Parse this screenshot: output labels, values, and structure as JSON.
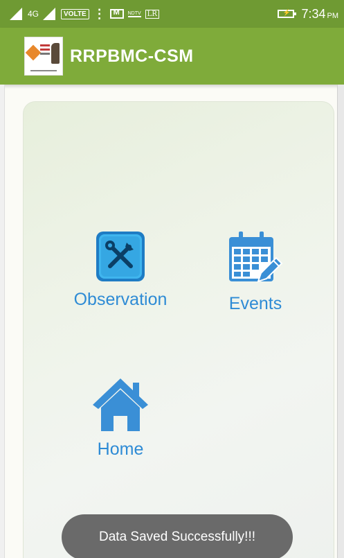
{
  "status_bar": {
    "network_label": "4G",
    "volte_label": "VOLTE",
    "ndtv_label": "NDTV",
    "lr_label": "LR",
    "time": "7:34",
    "ampm": "PM"
  },
  "app_bar": {
    "title": "RRPBMC-CSM",
    "color": "#7fab3a"
  },
  "menu": {
    "items": [
      {
        "label": "Observation",
        "icon": "tools-icon"
      },
      {
        "label": "Events",
        "icon": "calendar-edit-icon"
      },
      {
        "label": "Home",
        "icon": "home-icon"
      }
    ],
    "accent_color": "#2e8bd5"
  },
  "toast": {
    "message": "Data Saved Successfully!!!"
  }
}
